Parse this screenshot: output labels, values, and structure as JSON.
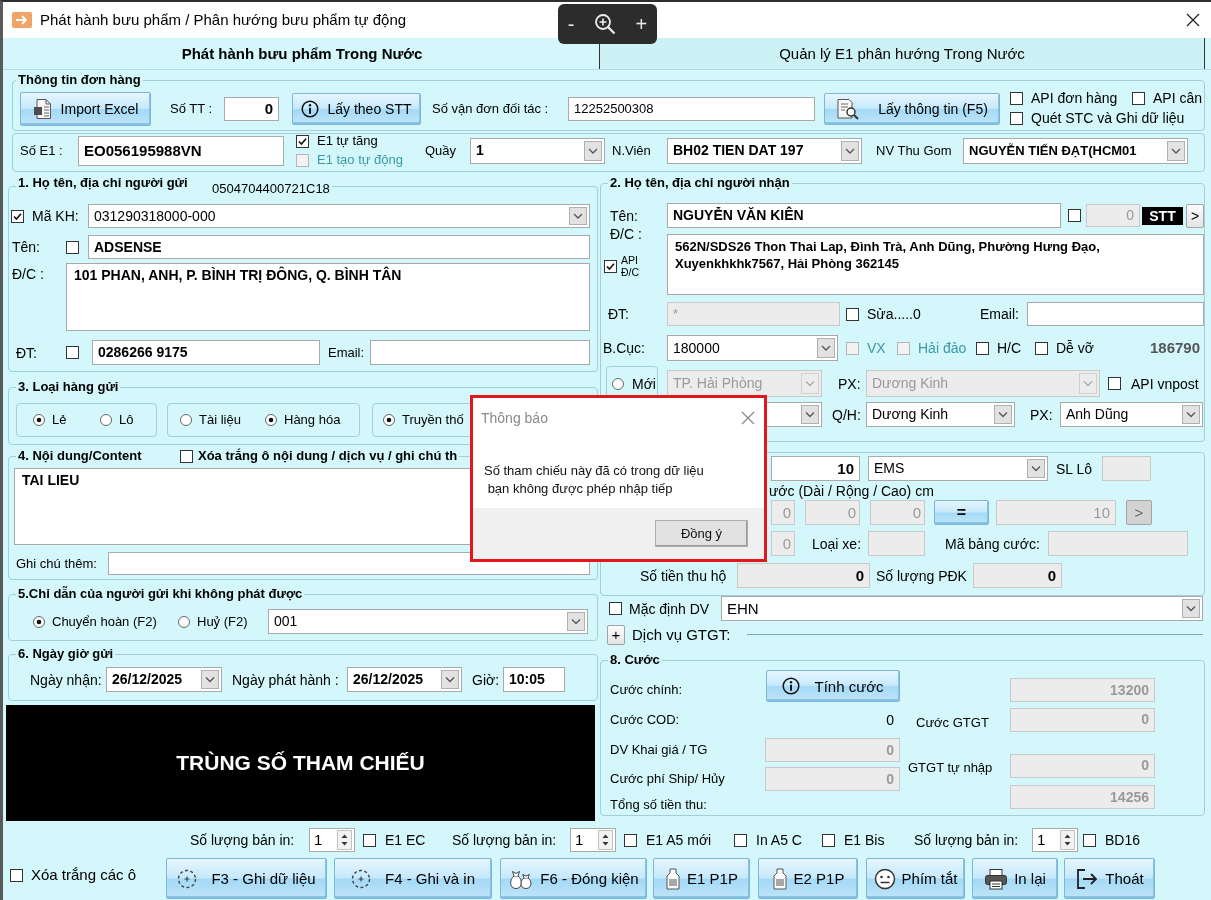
{
  "window": {
    "title": "Phát hành bưu phẩm / Phân hướng bưu phẩm tự động"
  },
  "zoom_toolbar": {
    "zoom_out": "-",
    "zoom_in": "+"
  },
  "tabs": [
    {
      "label": "Phát hành bưu phẩm Trong Nước",
      "selected": true
    },
    {
      "label": "Quản lý E1 phân hướng Trong Nước",
      "selected": false
    }
  ],
  "order_info": {
    "legend": "Thông tin đơn hàng",
    "import_button": "Import Excel",
    "stt_label": "Số TT :",
    "stt_value": "0",
    "stt_button": "Lấy theo STT",
    "partner_waybill_label": "Số vận đơn đối tác :",
    "partner_waybill_value": "12252500308",
    "fetch_button": "Lấy thông tin (F5)",
    "options": [
      {
        "label": "API đơn hàng",
        "checked": false
      },
      {
        "label": "API cân",
        "checked": false
      },
      {
        "label": "Quét STC và Ghi dữ liệu",
        "checked": false
      }
    ]
  },
  "e1_row": {
    "e1_label": "Số E1 :",
    "e1_value": "EO056195988VN",
    "e1_options": [
      {
        "label": "E1 tự tăng",
        "checked": true,
        "disabled": false
      },
      {
        "label": "E1 tạo tự động",
        "checked": false,
        "disabled": true
      }
    ],
    "counter_label": "Quầy",
    "counter_value": "1",
    "staff_label": "N.Viên",
    "staff_value": "BH02 TIEN DAT 197",
    "collector_label": "NV Thu Gom",
    "collector_value": "NGUYỄN TIẾN ĐẠT(HCM01"
  },
  "sender": {
    "legend": "1. Họ tên, địa chỉ người gửi",
    "reference": "0504704400721C18",
    "customer_code": {
      "label": "Mã KH:",
      "checked": true,
      "value": "031290318000-000"
    },
    "name": {
      "label": "Tên:",
      "checked": false,
      "value": "ADSENSE"
    },
    "address": {
      "label": "Đ/C :",
      "value": "101 PHAN, ANH, P. BÌNH TRỊ ĐÔNG, Q. BÌNH TÂN"
    },
    "phone": {
      "label": "ĐT:",
      "checked": false,
      "value": "0286266 9175"
    },
    "email": {
      "label": "Email:"
    }
  },
  "goods_type": {
    "legend": "3. Loại hàng gửi",
    "groups": [
      {
        "options": [
          {
            "label": "Lẻ",
            "selected": true
          },
          {
            "label": "Lô",
            "selected": false
          }
        ]
      },
      {
        "options": [
          {
            "label": "Tài liệu",
            "selected": false
          },
          {
            "label": "Hàng hóa",
            "selected": true
          }
        ]
      },
      {
        "options": [
          {
            "label": "Truyền thố",
            "selected": true
          }
        ]
      }
    ]
  },
  "content": {
    "legend": "4. Nội dung/Content",
    "clear_option": {
      "label": "Xóa trắng ô nội dung / dịch vụ / ghi chú th",
      "checked": false
    },
    "value": "TAI LIEU",
    "note_label": "Ghi chú thêm:"
  },
  "undeliverable": {
    "legend": "5.Chỉ dẫn của người gửi khi không phát được",
    "options": [
      {
        "label": "Chuyển hoàn (F2)",
        "selected": true
      },
      {
        "label": "Huỷ (F2)",
        "selected": false
      }
    ],
    "reason_value": "001"
  },
  "send_time": {
    "legend": "6. Ngày giờ gửi",
    "received_label": "Ngày nhận:",
    "received_value": "26/12/2025",
    "issued_label": "Ngày phát hành :",
    "issued_value": "26/12/2025",
    "time_label": "Giờ:",
    "time_value": "10:05"
  },
  "alert_banner": {
    "text": "TRÙNG SỐ THAM CHIẾU"
  },
  "recipient": {
    "legend": "2. Họ tên, địa chỉ người nhận",
    "name_label": "Tên:",
    "name_value": "NGUYỄN VĂN KIÊN",
    "stt_checked": false,
    "stt_field": {
      "value": "0",
      "disabled": true
    },
    "stt_tag": "STT",
    "next_button": ">",
    "address_label": "Đ/C :",
    "api_address": {
      "label": "API Đ/C",
      "checked": true
    },
    "address_value": "562N/SDS26 Thon Thai Lap, Đình Trà, Anh Dũng, Phường Hưng Đạo, Xuyenkhkhk7567, Hải Phòng 362145",
    "phone_label": "ĐT:",
    "phone_field": {
      "value": "*",
      "disabled": true
    },
    "edit_option": {
      "label": "Sửa.....0",
      "checked": false
    },
    "email_label": "Email:",
    "postcode_label": "B.Cục:",
    "postcode_value": "180000",
    "flags": [
      {
        "label": "VX",
        "checked": false,
        "disabled": true
      },
      {
        "label": "Hải đảo",
        "checked": false,
        "disabled": true
      },
      {
        "label": "H/C",
        "checked": false,
        "disabled": false
      },
      {
        "label": "Dễ vỡ",
        "checked": false,
        "disabled": false
      }
    ],
    "postcode_number": "186790",
    "new_option": {
      "label": "Mới",
      "selected": false
    },
    "old_province": {
      "value": "TP. Hải Phòng",
      "disabled": true
    },
    "old_ward_label": "PX:",
    "old_ward": {
      "value": "Dương Kinh",
      "disabled": true
    },
    "api_vnpost": {
      "label": "API vnpost",
      "checked": false
    },
    "district_label": "Q/H:",
    "district_value": "Dương Kinh",
    "ward_label": "PX:",
    "ward_value": "Anh Dũng"
  },
  "parcel": {
    "weight_value": "10",
    "service_value": "EMS",
    "lot_label": "SL Lô",
    "lot_field": {
      "disabled": true
    },
    "size_label": "ước (Dài / Rộng / Cao) cm",
    "size_fields": [
      {
        "value": "0",
        "disabled": true
      },
      {
        "value": "0",
        "disabled": true
      },
      {
        "value": "0",
        "disabled": true
      }
    ],
    "equals_button": "=",
    "converted_field": {
      "value": "10",
      "disabled": true
    },
    "more_button": {
      "label": ">",
      "disabled": true
    },
    "extra_field": {
      "value": "0",
      "disabled": true
    },
    "vehicle_label": "Loại xe:",
    "vehicle_field": {
      "disabled": true
    },
    "rate_table_label": "Mã bảng cước:",
    "rate_table_field": {
      "disabled": true
    },
    "cod_label": "Số tiền thu hộ",
    "cod_field": {
      "value": "0",
      "readonly": true
    },
    "pdk_label": "Số lượng PĐK",
    "pdk_field": {
      "value": "0",
      "readonly": true
    }
  },
  "services": {
    "default_option": {
      "label": "Mặc định DV",
      "checked": false
    },
    "value": "EHN",
    "expand_button": "+",
    "vas_label": "Dịch vụ GTGT:"
  },
  "fees": {
    "legend": "8. Cước",
    "main_label": "Cước chính:",
    "calc_button": "Tính cước",
    "main_field": {
      "value": "13200",
      "disabled": true
    },
    "cod_label": "Cước COD:",
    "cod_value": "0",
    "vas_label": "Cước GTGT",
    "vas_field": {
      "value": "0",
      "disabled": true
    },
    "declared_label": "DV Khai giá / TG",
    "declared_field": {
      "value": "0",
      "disabled": true
    },
    "manual_vas_label": "GTGT tự nhập",
    "manual_vas_field": {
      "value": "0",
      "disabled": true
    },
    "ship_label": "Cước phí Ship/ Hủy",
    "ship_field": {
      "value": "0",
      "disabled": true
    },
    "total_label": "Tổng số tiền thu:",
    "total_field": {
      "value": "14256",
      "disabled": true
    }
  },
  "print_options": [
    {
      "kind": "copies",
      "label": "Số lượng bản in:",
      "value": "1"
    },
    {
      "kind": "check",
      "label": "E1 EC",
      "checked": false
    },
    {
      "kind": "copies",
      "label": "Số lượng bản in:",
      "value": "1"
    },
    {
      "kind": "check",
      "label": "E1 A5 mới",
      "checked": false
    },
    {
      "kind": "check",
      "label": "In A5 C",
      "checked": false
    },
    {
      "kind": "check",
      "label": "E1 Bis",
      "checked": false
    },
    {
      "kind": "copies",
      "label": "Số lượng bản in:",
      "value": "1"
    },
    {
      "kind": "check",
      "label": "BD16",
      "checked": false
    }
  ],
  "actions": {
    "clear_all": {
      "label": "Xóa trắng các ô",
      "checked": false
    },
    "buttons": [
      "F3 - Ghi dữ liệu",
      "F4 - Ghi và in",
      "F6 - Đóng kiện",
      "E1 P1P",
      "E2 P1P",
      "Phím tắt",
      "In lại",
      "Thoát"
    ]
  },
  "dialog": {
    "title": "Thông báo",
    "message": "Số tham chiếu này đã có trong dữ liệu\n bạn không được phép nhập tiếp",
    "ok_button": "Đồng ý"
  }
}
